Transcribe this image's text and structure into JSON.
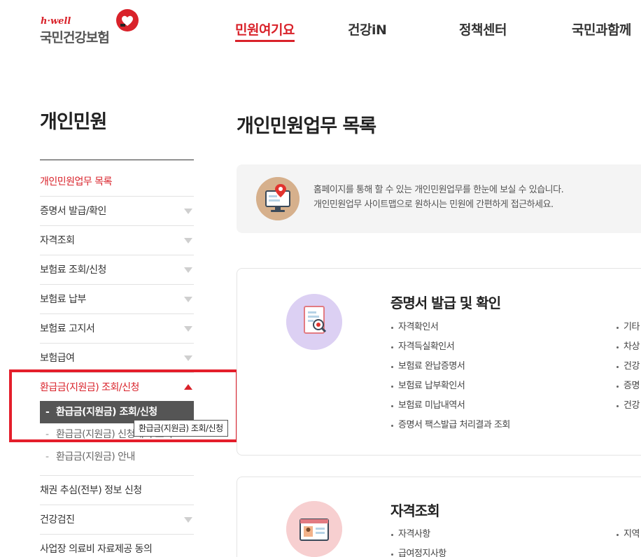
{
  "header": {
    "logo_top": "h·well",
    "logo_name": "국민건강보험",
    "nav": [
      "민원여기요",
      "건강iN",
      "정책센터",
      "국민과함께"
    ],
    "active_nav": 0
  },
  "sidebar": {
    "title": "개인민원",
    "items": [
      {
        "label": "개인민원업무 목록",
        "active": true,
        "arrow": false
      },
      {
        "label": "증명서 발급/확인",
        "arrow": true
      },
      {
        "label": "자격조회",
        "arrow": true
      },
      {
        "label": "보험료 조회/신청",
        "arrow": true
      },
      {
        "label": "보험료 납부",
        "arrow": true
      },
      {
        "label": "보험료 고지서",
        "arrow": true
      },
      {
        "label": "보험급여",
        "arrow": true
      },
      {
        "label": "환급금(지원금) 조회/신청",
        "open": true,
        "arrow": true
      },
      {
        "label": "채권 추심(전부) 정보 신청",
        "arrow": false
      },
      {
        "label": "건강검진",
        "arrow": true
      },
      {
        "label": "사업장 의료비 자료제공 동의",
        "arrow": false
      }
    ],
    "sub_items": [
      {
        "label": "환급금(지원금) 조회/신청",
        "current": true
      },
      {
        "label": "환급금(지원금) 신청내역 조회",
        "current": false
      },
      {
        "label": "환급금(지원금) 안내",
        "current": false
      }
    ],
    "tooltip": "환급금(지원금) 조회/신청"
  },
  "main": {
    "title": "개인민원업무 목록",
    "info_lines": [
      "홈페이지를 통해 할 수 있는 개인민원업무를 한눈에 보실 수 있습니다.",
      "개인민원업무 사이트맵으로 원하시는 민원에 간편하게 접근하세요."
    ],
    "cards": [
      {
        "title": "증명서 발급 및 확인",
        "col1": [
          "자격확인서",
          "자격득실확인서",
          "보험료 완납증명서",
          "보험료 납부확인서",
          "보험료 미납내역서",
          "증명서 팩스발급 처리결과 조회"
        ],
        "col2": [
          "기타",
          "차상",
          "건강",
          "증명",
          "건강"
        ]
      },
      {
        "title": "자격조회",
        "col1": [
          "자격사항",
          "급여정지사항"
        ],
        "col2": [
          "지역"
        ]
      }
    ]
  },
  "colors": {
    "brand_red": "#d9222a",
    "highlight_red": "#e41e2b",
    "submenu_bg": "#555555"
  }
}
